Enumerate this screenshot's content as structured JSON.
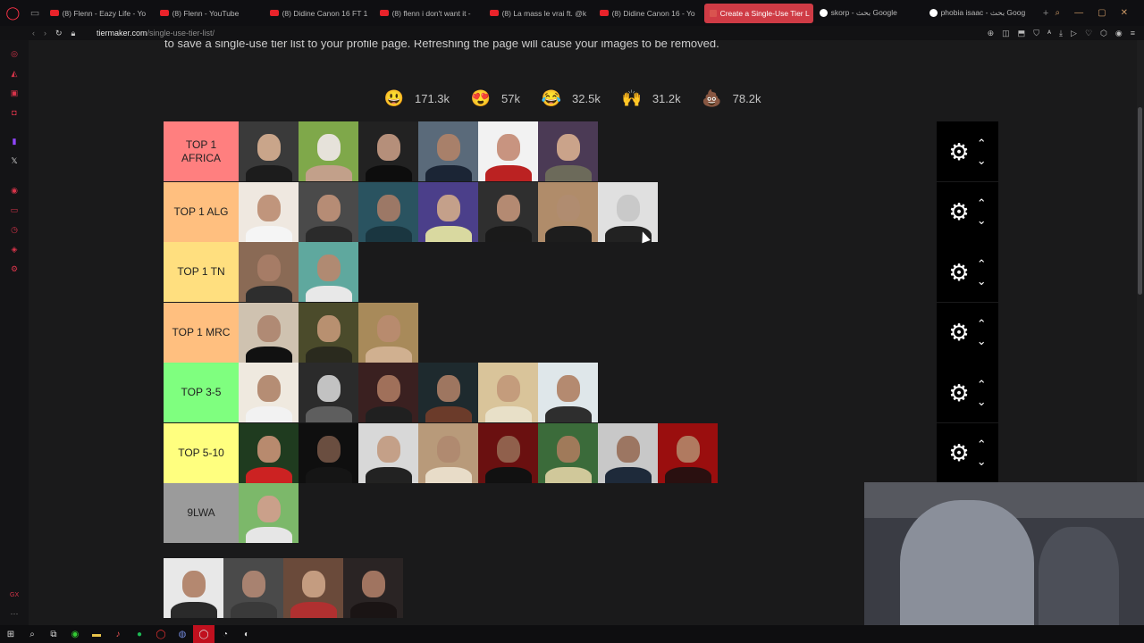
{
  "browser": {
    "tabs": [
      {
        "label": "(8) Flenn - Eazy Life - Yo",
        "favicon": "youtube",
        "active": false
      },
      {
        "label": "(8) Flenn - YouTube",
        "favicon": "youtube",
        "active": false
      },
      {
        "label": "(8) Didine Canon 16 FT 1",
        "favicon": "youtube",
        "active": false
      },
      {
        "label": "(8) flenn i don't want it -",
        "favicon": "youtube",
        "active": false
      },
      {
        "label": "(8) La mass le vrai ft. @k",
        "favicon": "youtube",
        "active": false
      },
      {
        "label": "(8) Didine Canon 16 - Yo",
        "favicon": "youtube",
        "active": false
      },
      {
        "label": "Create a Single-Use Tier L",
        "favicon": "tiermaker",
        "active": true
      },
      {
        "label": "skorp - بحث Google",
        "favicon": "google",
        "active": false
      },
      {
        "label": "phobia isaac - بحث Goog",
        "favicon": "google",
        "active": false
      }
    ],
    "url_domain": "tiermaker.com",
    "url_path": "/single-use-tier-list/"
  },
  "page": {
    "intro_text": "to save a single-use tier list to your profile page. Refreshing the page will cause your images to be removed."
  },
  "reactions": [
    {
      "emoji": "😃",
      "count": "171.3k",
      "icon": "smiley-icon"
    },
    {
      "emoji": "😍",
      "count": "57k",
      "icon": "heart-eyes-icon"
    },
    {
      "emoji": "😂",
      "count": "32.5k",
      "icon": "laughing-icon"
    },
    {
      "emoji": "🙌",
      "count": "31.2k",
      "icon": "raised-hands-icon"
    },
    {
      "emoji": "💩",
      "count": "78.2k",
      "icon": "poop-icon"
    }
  ],
  "tiers": [
    {
      "label": "TOP 1 AFRICA",
      "color": "#ff7f7f",
      "item_count": 6
    },
    {
      "label": "TOP 1 ALG",
      "color": "#ffbf7f",
      "item_count": 7
    },
    {
      "label": "TOP 1 TN",
      "color": "#ffdf7f",
      "item_count": 2
    },
    {
      "label": "TOP 1 MRC",
      "color": "#ffbf7f",
      "item_count": 3
    },
    {
      "label": "TOP 3-5",
      "color": "#7fff7f",
      "item_count": 6
    },
    {
      "label": "TOP 5-10",
      "color": "#ffff7f",
      "item_count": 8
    },
    {
      "label": "9LWA",
      "color": "#9b9b9b",
      "item_count": 1
    }
  ],
  "pool_item_count": 4,
  "controls": {
    "gear_icon": "⚙",
    "up_icon": "⌃",
    "down_icon": "⌄"
  }
}
